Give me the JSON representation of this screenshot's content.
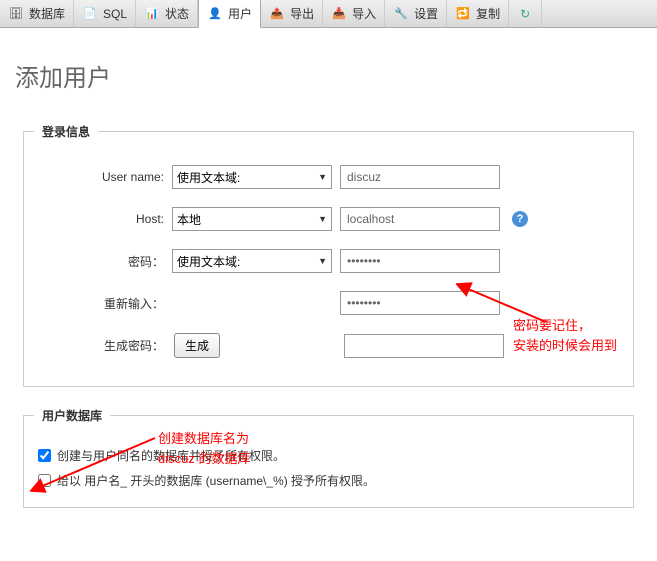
{
  "tabs": [
    {
      "label": "数据库",
      "icon": "db"
    },
    {
      "label": "SQL",
      "icon": "sql"
    },
    {
      "label": "状态",
      "icon": "status"
    },
    {
      "label": "用户",
      "icon": "users",
      "active": true
    },
    {
      "label": "导出",
      "icon": "export"
    },
    {
      "label": "导入",
      "icon": "import"
    },
    {
      "label": "设置",
      "icon": "settings"
    },
    {
      "label": "复制",
      "icon": "replication"
    }
  ],
  "page": {
    "title": "添加用户"
  },
  "login_info": {
    "legend": "登录信息",
    "username_label": "User name:",
    "username_select": "使用文本域:",
    "username_value": "discuz",
    "host_label": "Host:",
    "host_select": "本地",
    "host_value": "localhost",
    "password_label": "密码：",
    "password_select": "使用文本域:",
    "password_value": "••••••••",
    "retype_label": "重新输入：",
    "retype_value": "••••••••",
    "generate_label": "生成密码：",
    "generate_button": "生成",
    "generate_value": ""
  },
  "user_db": {
    "legend": "用户数据库",
    "checkbox1_label": "创建与用户同名的数据库并授予所有权限。",
    "checkbox1_checked": true,
    "checkbox2_label": "给以 用户名_ 开头的数据库 (username\\_%) 授予所有权限。",
    "checkbox2_checked": false
  },
  "annotations": {
    "pwd_note": "密码要记住，\n安装的时候会用到",
    "db_note": "创建数据库名为\ndiscuz 的数据库"
  }
}
